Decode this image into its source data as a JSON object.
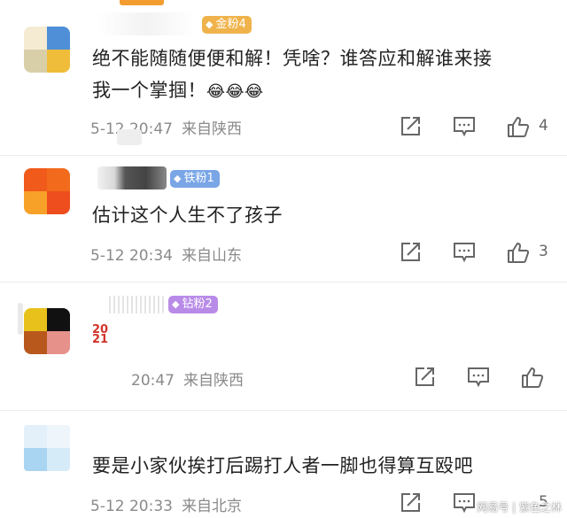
{
  "comments": [
    {
      "badge": "金粉4",
      "text_line1": "绝不能随随便便和解！凭啥？谁答应和解谁来接",
      "text_line2": "我一个掌掴！",
      "emojis": "😂😂😂",
      "time": "5-12 20:47",
      "location": "来自陕西",
      "likes": "4"
    },
    {
      "badge": "铁粉1",
      "text_line1": "估计这个人生不了孩子",
      "time": "5-12 20:34",
      "location": "来自山东",
      "likes": "3"
    },
    {
      "badge": "钻粉2",
      "sticker": "2021",
      "time": "20:47",
      "location": "来自陕西",
      "likes": ""
    },
    {
      "text_line1": "要是小家伙挨打后踢打人者一脚也得算互殴吧",
      "time": "5-12 20:33",
      "location": "来自北京",
      "likes": "5"
    }
  ],
  "watermark": "网易号 | 紫色之林",
  "colors": {
    "gold_badge": "#f0b34b",
    "iron_badge": "#7aa6e6",
    "diamond_badge": "#b98be8",
    "meta_text": "#8a8a8a"
  },
  "icons": [
    "share-icon",
    "comment-icon",
    "thumbs-up-icon"
  ]
}
